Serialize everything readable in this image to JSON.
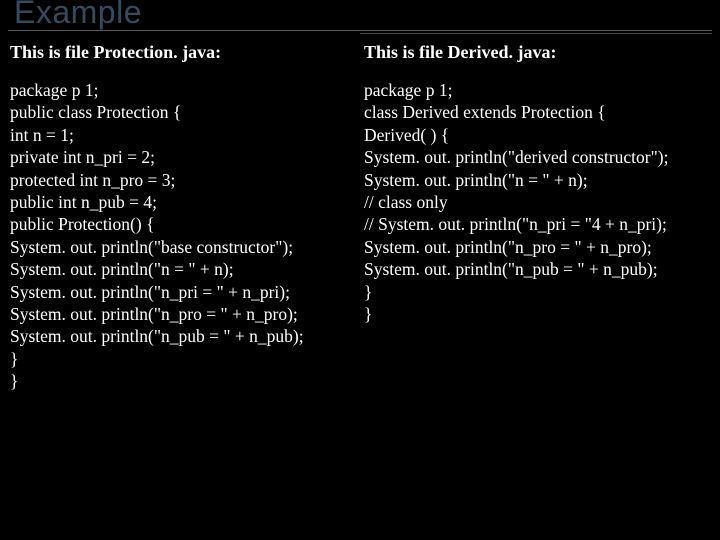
{
  "title": "Example",
  "left": {
    "heading": "This is file Protection. java:",
    "code": "package p 1;\npublic class Protection {\nint n = 1;\nprivate int n_pri = 2;\nprotected int n_pro = 3;\npublic int n_pub = 4;\npublic Protection() {\nSystem. out. println(\"base constructor\");\nSystem. out. println(\"n = \" + n);\nSystem. out. println(\"n_pri = \" + n_pri);\nSystem. out. println(\"n_pro = \" + n_pro);\nSystem. out. println(\"n_pub = \" + n_pub);\n}\n}"
  },
  "right": {
    "heading": "This is file Derived. java:",
    "code": "package p 1;\nclass Derived extends Protection {\nDerived( ) {\nSystem. out. println(\"derived constructor\");\nSystem. out. println(\"n = \" + n);\n// class only\n// System. out. println(\"n_pri = \"4 + n_pri);\nSystem. out. println(\"n_pro = \" + n_pro);\nSystem. out. println(\"n_pub = \" + n_pub);\n}\n}"
  }
}
